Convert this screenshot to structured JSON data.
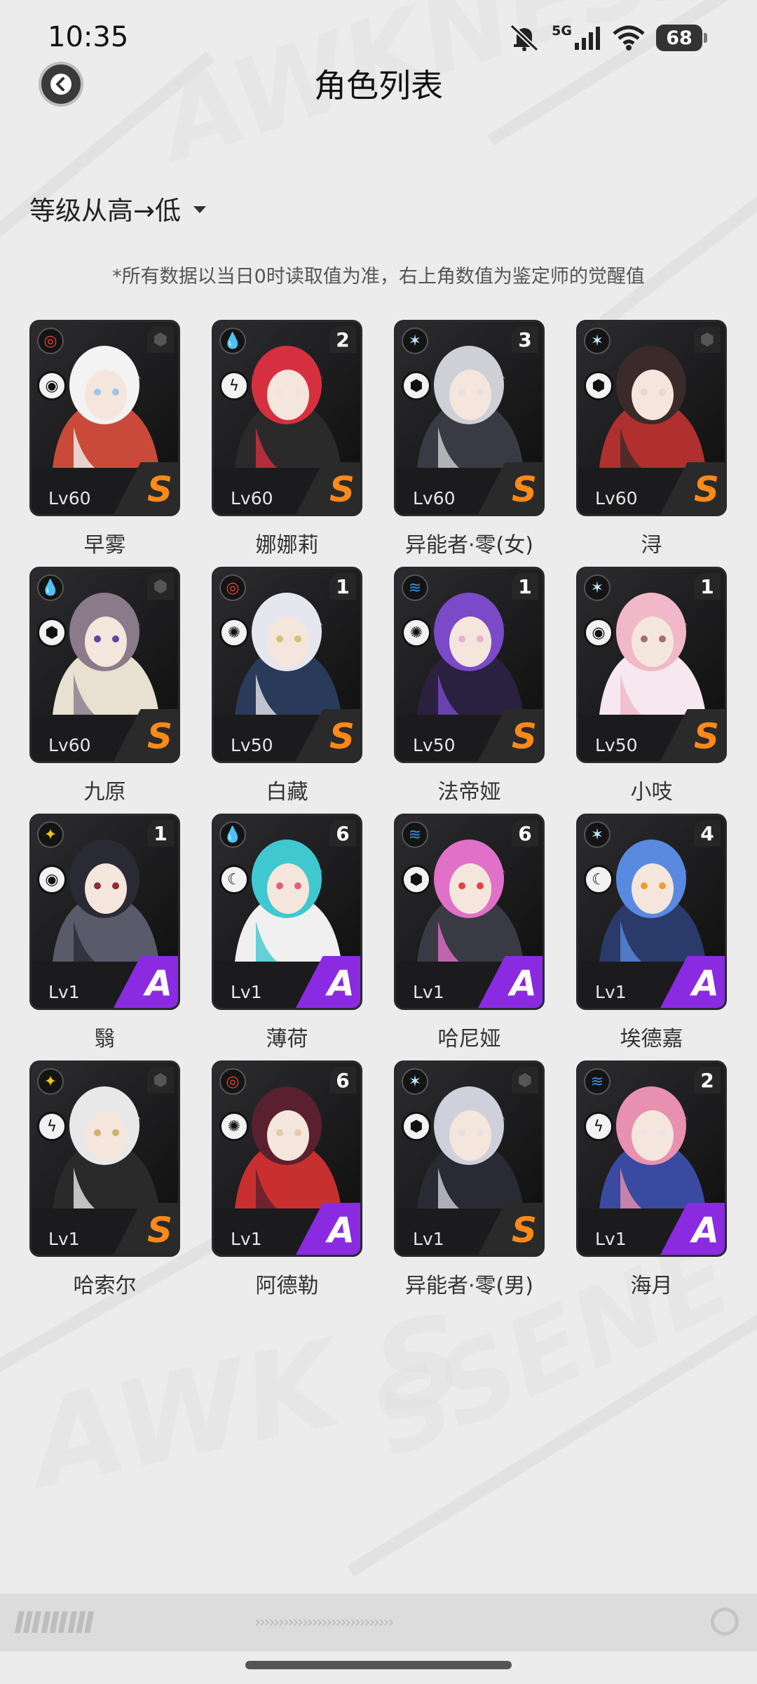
{
  "status_bar": {
    "time": "10:35",
    "network": "5G",
    "battery": "68"
  },
  "header": {
    "title": "角色列表",
    "back_icon": "back-arrow-icon"
  },
  "sort": {
    "label": "等级从高→低"
  },
  "note": "*所有数据以当日0时读取值为准，右上角数值为鉴定师的觉醒值",
  "colors": {
    "rank_s": "#ff8a1a",
    "rank_a": "#8a2be2",
    "attr_red": "#e8453c",
    "attr_green": "#3cc28a",
    "attr_blue": "#3b8fe8",
    "attr_yellow": "#f0c419",
    "attr_cyan": "#bfe6ff"
  },
  "characters": [
    {
      "name": "早雾",
      "level": "Lv60",
      "rank": "S",
      "awakening": "",
      "attr": "red",
      "role": "vortex-icon",
      "palette": [
        "#f3f3f3",
        "#c94a3a",
        "#9fc4e8"
      ]
    },
    {
      "name": "娜娜莉",
      "level": "Lv60",
      "rank": "S",
      "awakening": "2",
      "attr": "green",
      "role": "lightning-icon",
      "palette": [
        "#d63040",
        "#2a2a2a",
        "#f1e4dc"
      ]
    },
    {
      "name": "异能者·零(女)",
      "level": "Lv60",
      "rank": "S",
      "awakening": "3",
      "attr": "cyan",
      "role": "cube-icon",
      "palette": [
        "#cfcfd6",
        "#3a3a44",
        "#e8e0e0"
      ]
    },
    {
      "name": "浔",
      "level": "Lv60",
      "rank": "S",
      "awakening": "",
      "attr": "cyan",
      "role": "cube-icon",
      "palette": [
        "#3a2a2a",
        "#b03030",
        "#e6d9d0"
      ]
    },
    {
      "name": "九原",
      "level": "Lv60",
      "rank": "S",
      "awakening": "",
      "attr": "green",
      "role": "cube-icon",
      "palette": [
        "#8a7a8a",
        "#e8e0d0",
        "#5a4aa0"
      ]
    },
    {
      "name": "白藏",
      "level": "Lv50",
      "rank": "S",
      "awakening": "1",
      "attr": "red",
      "role": "gear-icon",
      "palette": [
        "#e6e6ee",
        "#2a3a5a",
        "#d8c070"
      ]
    },
    {
      "name": "法帝娅",
      "level": "Lv50",
      "rank": "S",
      "awakening": "1",
      "attr": "blue",
      "role": "gear-icon",
      "palette": [
        "#7a4ac8",
        "#2a2040",
        "#e8b0d0"
      ]
    },
    {
      "name": "小吱",
      "level": "Lv50",
      "rank": "S",
      "awakening": "1",
      "attr": "cyan",
      "role": "vortex-icon",
      "palette": [
        "#f0b8c8",
        "#f6e8ee",
        "#a07070"
      ]
    },
    {
      "name": "翳",
      "level": "Lv1",
      "rank": "A",
      "awakening": "1",
      "attr": "yellow",
      "role": "vortex-icon",
      "palette": [
        "#2a2a34",
        "#5a5a6a",
        "#8a3030"
      ]
    },
    {
      "name": "薄荷",
      "level": "Lv1",
      "rank": "A",
      "awakening": "6",
      "attr": "green",
      "role": "moon-icon",
      "palette": [
        "#40c8d0",
        "#f0f0f0",
        "#e06080"
      ]
    },
    {
      "name": "哈尼娅",
      "level": "Lv1",
      "rank": "A",
      "awakening": "6",
      "attr": "blue",
      "role": "cube-icon",
      "palette": [
        "#e070c8",
        "#3a3a44",
        "#e84040"
      ]
    },
    {
      "name": "埃德嘉",
      "level": "Lv1",
      "rank": "A",
      "awakening": "4",
      "attr": "cyan",
      "role": "moon-icon",
      "palette": [
        "#5a8ae0",
        "#2a3a6a",
        "#e8a030"
      ]
    },
    {
      "name": "哈索尔",
      "level": "Lv1",
      "rank": "S",
      "awakening": "",
      "attr": "yellow",
      "role": "lightning-icon",
      "palette": [
        "#e8e8e8",
        "#2a2a2a",
        "#d0b070"
      ]
    },
    {
      "name": "阿德勒",
      "level": "Lv1",
      "rank": "A",
      "awakening": "6",
      "attr": "red",
      "role": "gear-icon",
      "palette": [
        "#5a2030",
        "#c83030",
        "#e8c8b0"
      ]
    },
    {
      "name": "异能者·零(男)",
      "level": "Lv1",
      "rank": "S",
      "awakening": "",
      "attr": "cyan",
      "role": "cube-icon",
      "palette": [
        "#d0d0dc",
        "#2a2a34",
        "#e8e0e0"
      ]
    },
    {
      "name": "海月",
      "level": "Lv1",
      "rank": "A",
      "awakening": "2",
      "attr": "blue",
      "role": "lightning-icon",
      "palette": [
        "#e890b0",
        "#3a4aa0",
        "#f0e0e8"
      ]
    }
  ],
  "footer": {
    "logo": "ⅢⅢⅢ"
  }
}
